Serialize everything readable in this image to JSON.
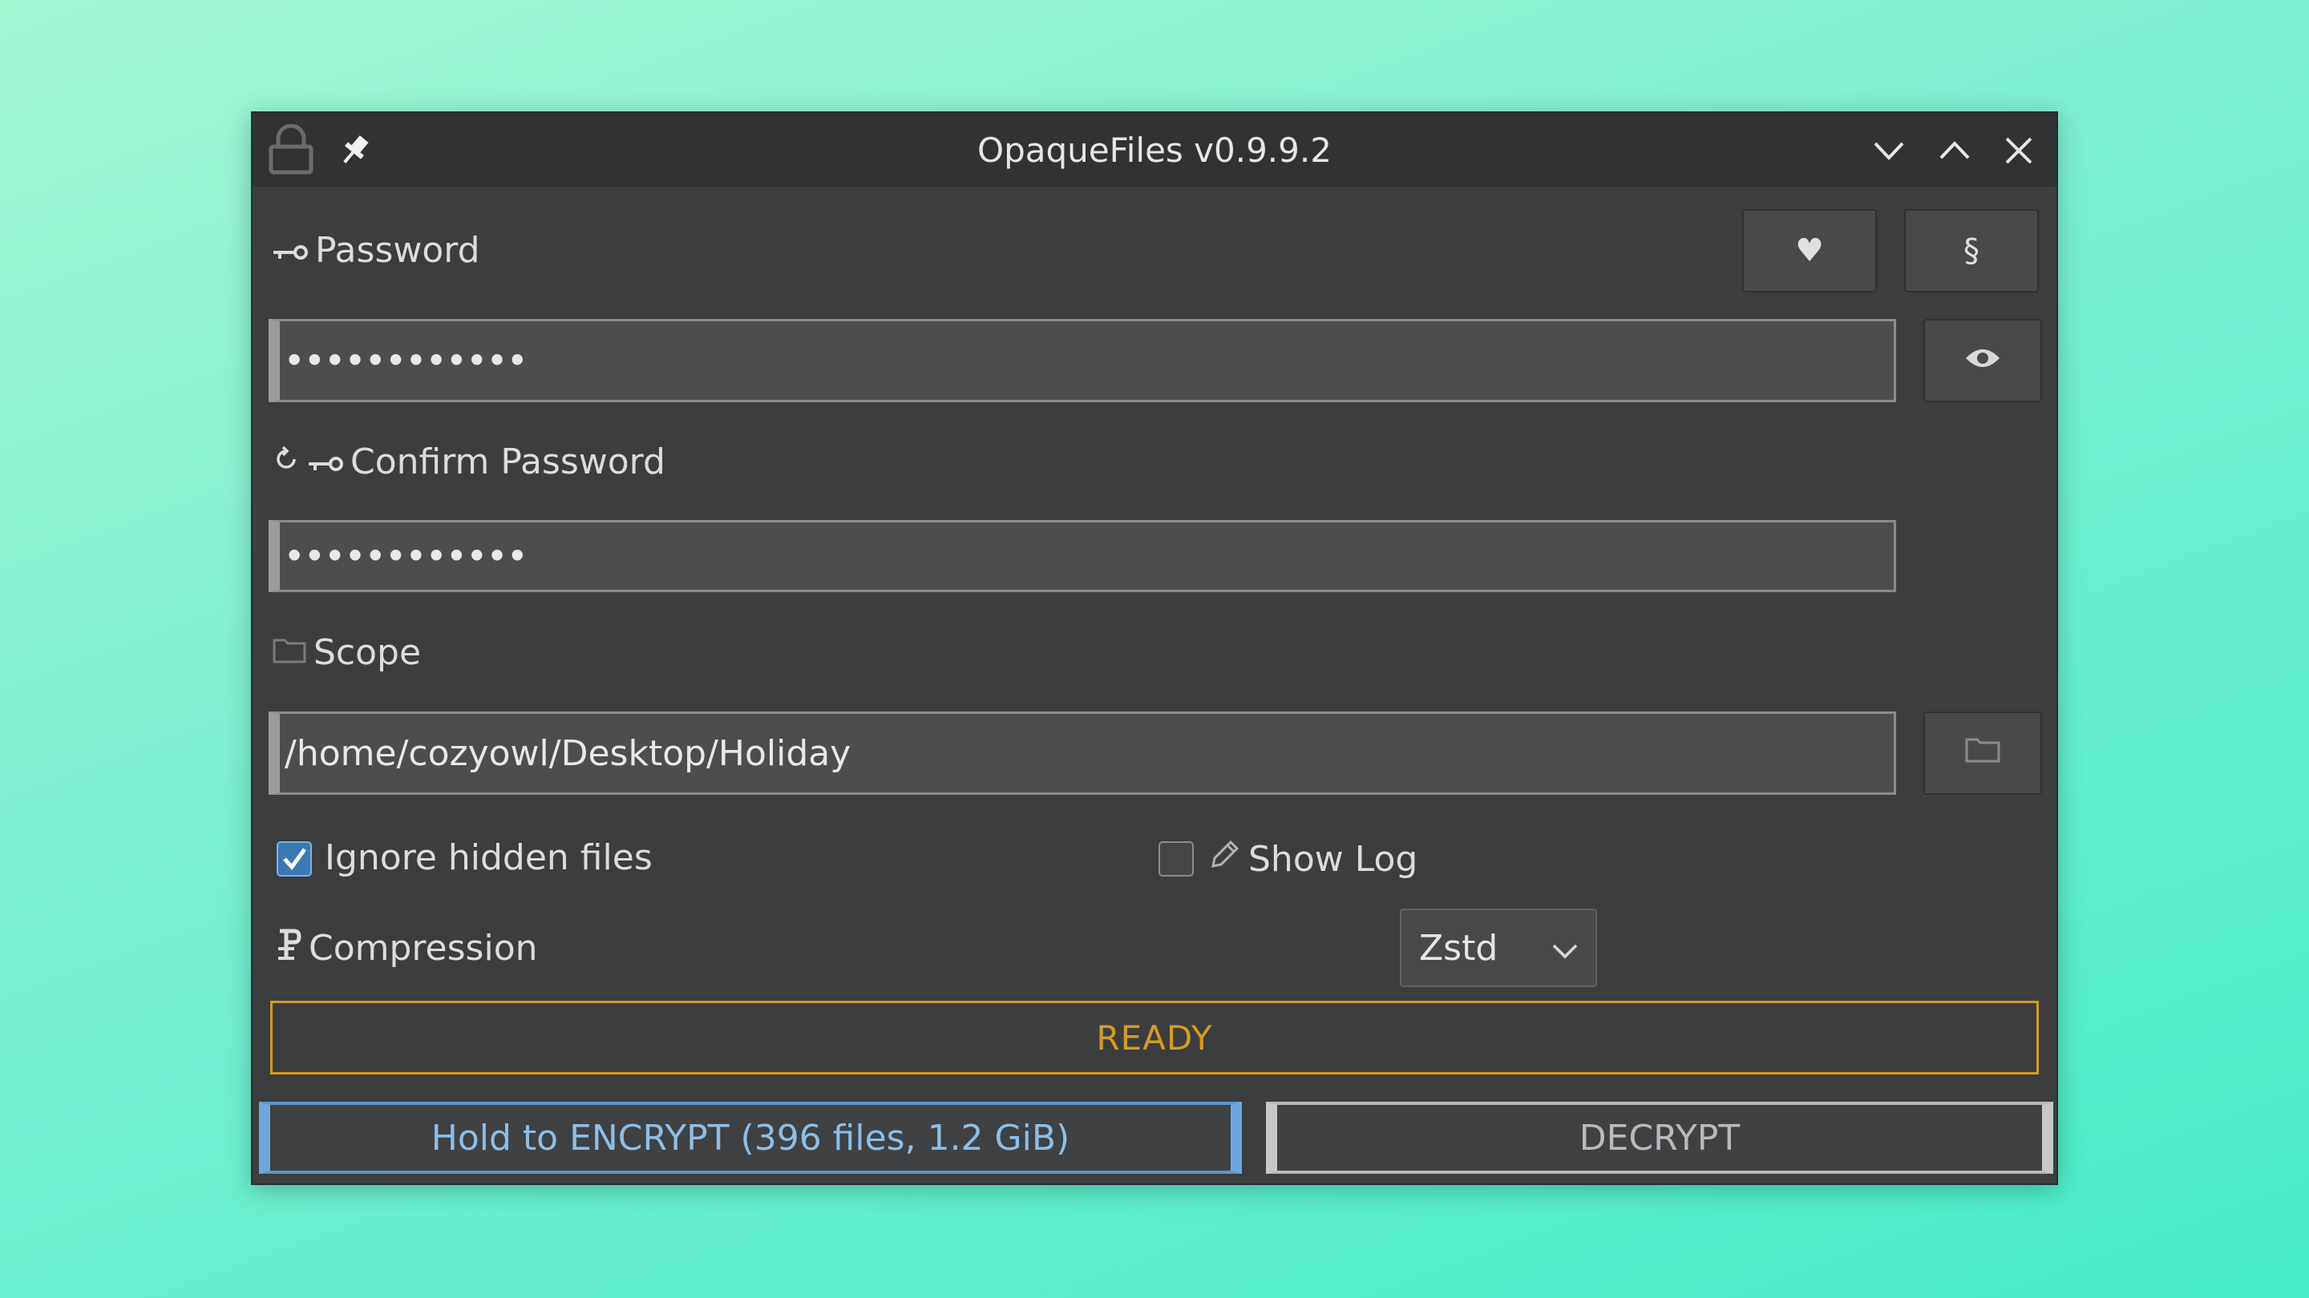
{
  "window": {
    "title": "OpaqueFiles v0.9.9.2",
    "icons": [
      "lock-icon",
      "pin-icon"
    ],
    "controls": [
      "minimize-icon",
      "maximize-icon",
      "close-icon"
    ]
  },
  "password": {
    "label": "Password",
    "value": "••••••••••••",
    "icon": "key-icon"
  },
  "header_buttons": {
    "favorite_label": "♥",
    "section_label": "§"
  },
  "confirm_password": {
    "label": "Confirm Password",
    "value": "••••••••••••"
  },
  "scope": {
    "label": "Scope",
    "path": "/home/cozyowl/Desktop/Holiday"
  },
  "options": {
    "ignore_hidden_label": "Ignore hidden files",
    "ignore_hidden_checked": true,
    "show_log_label": "Show Log",
    "show_log_checked": false
  },
  "compression": {
    "label": "Compression",
    "selected": "Zstd"
  },
  "status": {
    "text": "READY",
    "color": "#d69a24"
  },
  "actions": {
    "encrypt_label": "Hold to ENCRYPT (396 files, 1.2 GiB)",
    "decrypt_label": "DECRYPT"
  },
  "colors": {
    "accent": "#5b95cd",
    "status": "#d69a24",
    "window_bg": "#3b3d3f"
  }
}
